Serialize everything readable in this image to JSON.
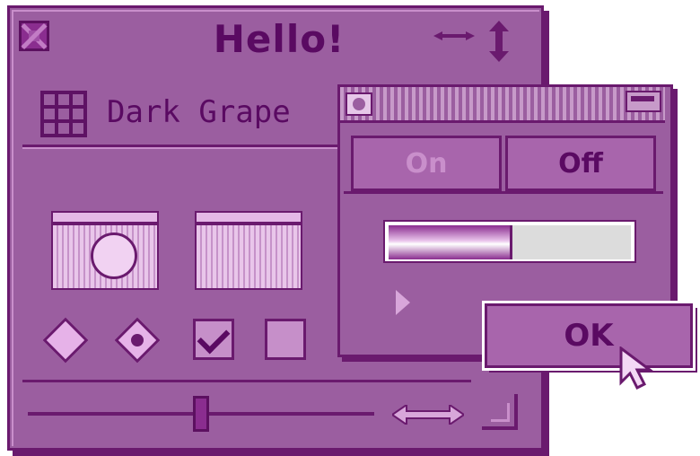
{
  "window": {
    "title": "Hello!",
    "header_label": "Dark Grape"
  },
  "palette": {
    "toggle_on_label": "On",
    "toggle_off_label": "Off",
    "progress_fraction": 0.5
  },
  "dialog": {
    "ok_label": "OK"
  },
  "controls": {
    "radio_1_selected": false,
    "radio_2_selected": true,
    "checkbox_1_checked": true,
    "checkbox_2_checked": false,
    "slider_value": 0.5
  },
  "colors": {
    "window_bg": "#9b5ea0",
    "outline": "#6a1a6e",
    "text": "#5a0a62",
    "highlight": "#c98fcb"
  },
  "icons": {
    "close": "close-box-icon",
    "zoom_horizontal": "horizontal-arrows-icon",
    "zoom_vertical": "vertical-arrows-icon",
    "header": "grid-icon",
    "folder_1": "folder-with-face-icon",
    "folder_2": "folder-icon",
    "cursor": "arrow-cursor-icon"
  }
}
